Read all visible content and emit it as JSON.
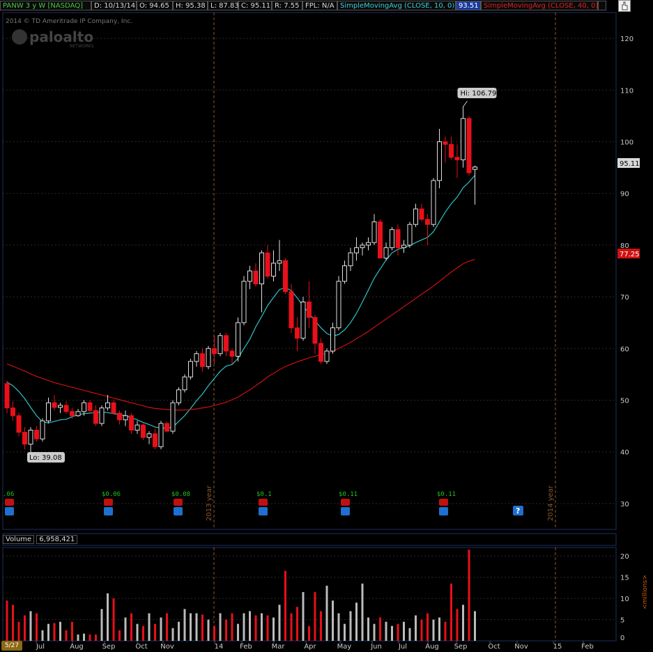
{
  "header": {
    "symbol": "PANW 3 y W [NASDAQ]",
    "date": "D: 10/13/14",
    "open": "O: 94.65",
    "high": "H: 95.38",
    "low": "L: 87.83",
    "close": "C: 95.11",
    "range": "R: 7.55",
    "fpl": "FPL: N/A",
    "sma_fast_label": "SimpleMovingAvg (CLOSE, 10, 0)",
    "sma_fast_value": "93.51",
    "sma_slow_label": "SimpleMovingAvg (CLOSE, 40, 0)",
    "sma_slow_value": "",
    "cursor_icon": "hand-cursor-icon"
  },
  "watermark": {
    "copyright": "2014 © TD Ameritrade IP Company, Inc.",
    "logo": "paloalto",
    "logo_sub": "NETWORKS"
  },
  "price_axis": {
    "ticks": [
      "120",
      "110",
      "100",
      "90",
      "80",
      "70",
      "60",
      "50",
      "40",
      "30"
    ],
    "last_price_tag": "95.11",
    "sma_slow_tag": "77.25"
  },
  "annotations": {
    "high": "Hi: 106.79",
    "low": "Lo: 39.08",
    "year_2013": "2013 year",
    "year_2014": "2014 year"
  },
  "dividends": [
    ".06",
    "$0.06",
    "$0.08",
    "$0.1",
    "$0.11",
    "$0.11"
  ],
  "volume_panel": {
    "label": "Volume",
    "value": "6,958,421",
    "ticks": [
      "20",
      "15",
      "10",
      "5"
    ],
    "unit_label": "<millions>"
  },
  "time_axis": {
    "date_badge": "5/27",
    "labels": [
      "Jul",
      "Aug",
      "Sep",
      "Oct",
      "Nov",
      "14",
      "Feb",
      "Mar",
      "Apr",
      "May",
      "Jun",
      "Jul",
      "Aug",
      "Sep",
      "Oct",
      "Nov",
      "15",
      "Feb"
    ]
  },
  "colors": {
    "up": "#e0e0e0",
    "down": "#e8101a",
    "sma_fast": "#2ec4c8",
    "sma_slow": "#cc1010",
    "grid": "#2a2a2a",
    "year_marker": "#8b5a2b"
  },
  "chart_data": {
    "type": "candlestick",
    "period": "weekly",
    "ohlc": [
      [
        53.2,
        53.8,
        47.5,
        48.5
      ],
      [
        48.5,
        49.8,
        46.0,
        47.0
      ],
      [
        47.0,
        47.6,
        43.0,
        43.8
      ],
      [
        43.8,
        44.8,
        40.5,
        41.5
      ],
      [
        41.5,
        44.8,
        40.0,
        44.2
      ],
      [
        44.2,
        45.0,
        42.0,
        42.5
      ],
      [
        42.5,
        46.5,
        42.0,
        46.0
      ],
      [
        46.0,
        50.5,
        45.5,
        49.5
      ],
      [
        49.5,
        51.0,
        48.0,
        48.6
      ],
      [
        48.6,
        49.5,
        47.5,
        49.0
      ],
      [
        49.0,
        49.8,
        47.4,
        47.8
      ],
      [
        47.8,
        48.5,
        46.4,
        47.0
      ],
      [
        47.0,
        48.3,
        46.8,
        47.8
      ],
      [
        47.8,
        50.0,
        47.0,
        49.5
      ],
      [
        49.5,
        50.0,
        47.5,
        48.0
      ],
      [
        48.0,
        49.0,
        45.0,
        45.5
      ],
      [
        45.5,
        49.0,
        45.0,
        48.5
      ],
      [
        48.5,
        51.0,
        48.0,
        49.5
      ],
      [
        49.5,
        50.0,
        47.2,
        47.5
      ],
      [
        47.5,
        48.0,
        45.3,
        46.2
      ],
      [
        46.2,
        48.0,
        45.0,
        47.0
      ],
      [
        47.0,
        47.5,
        43.5,
        44.2
      ],
      [
        44.2,
        46.0,
        43.5,
        45.2
      ],
      [
        45.2,
        45.5,
        42.3,
        42.8
      ],
      [
        42.8,
        44.0,
        41.5,
        43.5
      ],
      [
        43.5,
        44.5,
        40.5,
        41.0
      ],
      [
        41.0,
        46.0,
        40.5,
        45.5
      ],
      [
        45.5,
        45.8,
        43.8,
        44.0
      ],
      [
        44.0,
        50.0,
        43.5,
        49.5
      ],
      [
        49.5,
        52.5,
        49.0,
        52.0
      ],
      [
        52.0,
        55.0,
        51.5,
        54.5
      ],
      [
        54.5,
        58.0,
        54.0,
        57.5
      ],
      [
        57.5,
        59.5,
        56.5,
        59.0
      ],
      [
        59.0,
        60.0,
        55.5,
        56.5
      ],
      [
        56.5,
        60.5,
        56.0,
        60.0
      ],
      [
        60.0,
        62.5,
        57.0,
        59.0
      ],
      [
        59.0,
        63.0,
        58.5,
        62.5
      ],
      [
        62.5,
        63.0,
        58.5,
        59.5
      ],
      [
        59.5,
        60.0,
        57.0,
        58.5
      ],
      [
        58.5,
        66.0,
        57.5,
        65.0
      ],
      [
        65.0,
        74.0,
        64.5,
        73.0
      ],
      [
        73.0,
        76.0,
        71.5,
        75.0
      ],
      [
        75.0,
        76.5,
        72.0,
        72.5
      ],
      [
        72.5,
        79.0,
        67.0,
        78.5
      ],
      [
        78.5,
        80.0,
        73.5,
        74.0
      ],
      [
        74.0,
        79.0,
        73.0,
        76.5
      ],
      [
        76.5,
        81.0,
        75.0,
        77.0
      ],
      [
        77.0,
        77.5,
        70.5,
        71.0
      ],
      [
        71.0,
        72.5,
        63.0,
        64.0
      ],
      [
        64.0,
        66.0,
        59.5,
        62.0
      ],
      [
        62.0,
        70.0,
        61.5,
        69.0
      ],
      [
        69.0,
        73.0,
        64.0,
        66.0
      ],
      [
        66.0,
        66.5,
        59.0,
        61.0
      ],
      [
        61.0,
        62.0,
        57.0,
        57.5
      ],
      [
        57.5,
        60.0,
        57.0,
        59.5
      ],
      [
        59.5,
        65.0,
        59.0,
        64.0
      ],
      [
        64.0,
        74.0,
        63.5,
        73.0
      ],
      [
        73.0,
        77.0,
        72.5,
        76.0
      ],
      [
        76.0,
        79.5,
        75.0,
        78.5
      ],
      [
        78.5,
        81.5,
        77.0,
        79.5
      ],
      [
        79.5,
        80.5,
        78.0,
        80.0
      ],
      [
        80.0,
        81.5,
        79.0,
        80.5
      ],
      [
        80.5,
        86.0,
        80.0,
        84.5
      ],
      [
        84.5,
        85.0,
        79.0,
        77.5
      ],
      [
        77.5,
        80.5,
        77.0,
        79.5
      ],
      [
        79.5,
        83.5,
        79.0,
        83.0
      ],
      [
        83.0,
        84.0,
        78.0,
        79.5
      ],
      [
        79.5,
        81.0,
        78.5,
        80.0
      ],
      [
        80.0,
        84.5,
        79.5,
        84.0
      ],
      [
        84.0,
        88.0,
        83.5,
        87.0
      ],
      [
        87.0,
        88.0,
        84.5,
        85.0
      ],
      [
        85.0,
        86.0,
        80.0,
        84.0
      ],
      [
        84.0,
        93.0,
        83.5,
        92.5
      ],
      [
        92.5,
        102.5,
        91.0,
        100.0
      ],
      [
        100.0,
        101.0,
        96.0,
        99.5
      ],
      [
        99.5,
        101.0,
        96.5,
        97.0
      ],
      [
        97.0,
        99.5,
        93.0,
        96.5
      ],
      [
        96.5,
        106.8,
        95.0,
        104.5
      ],
      [
        104.5,
        105.0,
        93.5,
        94.0
      ],
      [
        94.65,
        95.38,
        87.83,
        95.11
      ]
    ],
    "sma10": [
      53.5,
      52.8,
      51.7,
      50.3,
      48.6,
      47.0,
      45.8,
      45.6,
      45.9,
      46.2,
      46.3,
      46.8,
      47.2,
      47.4,
      47.5,
      47.6,
      47.7,
      47.6,
      47.4,
      47.2,
      47.0,
      46.6,
      46.2,
      45.7,
      45.3,
      44.8,
      44.6,
      44.6,
      44.8,
      45.9,
      47.0,
      48.4,
      49.9,
      51.2,
      52.8,
      54.2,
      55.6,
      56.6,
      56.9,
      58.1,
      60.0,
      61.8,
      64.2,
      66.2,
      68.3,
      69.9,
      71.4,
      71.8,
      71.2,
      69.8,
      68.2,
      66.8,
      65.4,
      64.0,
      62.9,
      62.4,
      62.7,
      63.6,
      65.0,
      66.8,
      69.0,
      71.3,
      73.6,
      75.4,
      77.1,
      78.5,
      79.2,
      79.5,
      79.9,
      80.5,
      81.0,
      81.5,
      82.6,
      84.5,
      86.4,
      88.0,
      89.3,
      91.1,
      92.2,
      93.51
    ],
    "sma40": [
      57.0,
      56.6,
      56.1,
      55.6,
      55.1,
      54.6,
      54.2,
      53.8,
      53.4,
      53.1,
      52.8,
      52.5,
      52.2,
      51.9,
      51.6,
      51.3,
      51.0,
      50.7,
      50.4,
      50.1,
      49.8,
      49.5,
      49.2,
      48.9,
      48.6,
      48.4,
      48.3,
      48.2,
      48.1,
      48.1,
      48.1,
      48.2,
      48.3,
      48.5,
      48.7,
      49.0,
      49.3,
      49.6,
      50.1,
      50.6,
      51.3,
      52.0,
      52.8,
      53.6,
      54.5,
      55.2,
      55.9,
      56.5,
      57.0,
      57.4,
      57.8,
      58.2,
      58.5,
      58.8,
      59.1,
      59.5,
      60.0,
      60.6,
      61.2,
      61.9,
      62.6,
      63.3,
      64.1,
      64.9,
      65.7,
      66.5,
      67.3,
      68.1,
      68.9,
      69.7,
      70.5,
      71.3,
      72.1,
      73.0,
      73.9,
      74.8,
      75.6,
      76.4,
      76.9,
      77.25
    ],
    "volume_millions": [
      9.5,
      8.5,
      4.5,
      6.0,
      7.0,
      6.5,
      2.5,
      4.0,
      4.2,
      4.5,
      2.5,
      4.5,
      1.5,
      1.7,
      1.5,
      1.5,
      7.5,
      11.2,
      10.0,
      2.5,
      5.5,
      6.5,
      4.0,
      3.5,
      6.5,
      4.0,
      5.5,
      6.5,
      3.0,
      4.5,
      7.5,
      6.5,
      6.5,
      6.2,
      5.0,
      3.5,
      6.5,
      5.0,
      6.5,
      4.0,
      6.5,
      7.0,
      6.0,
      6.5,
      6.0,
      5.5,
      8.5,
      16.5,
      6.5,
      8.0,
      11.5,
      3.5,
      11.5,
      7.0,
      13.0,
      9.5,
      6.5,
      4.0,
      7.0,
      9.0,
      13.5,
      5.5,
      4.0,
      5.5,
      4.5,
      3.5,
      4.0,
      4.5,
      3.0,
      6.0,
      5.0,
      6.5,
      5.0,
      5.5,
      4.5,
      13.5,
      7.5,
      8.5,
      21.5,
      7.0
    ],
    "price_axis_range": [
      25,
      125
    ],
    "volume_axis_range": [
      0,
      22
    ]
  }
}
